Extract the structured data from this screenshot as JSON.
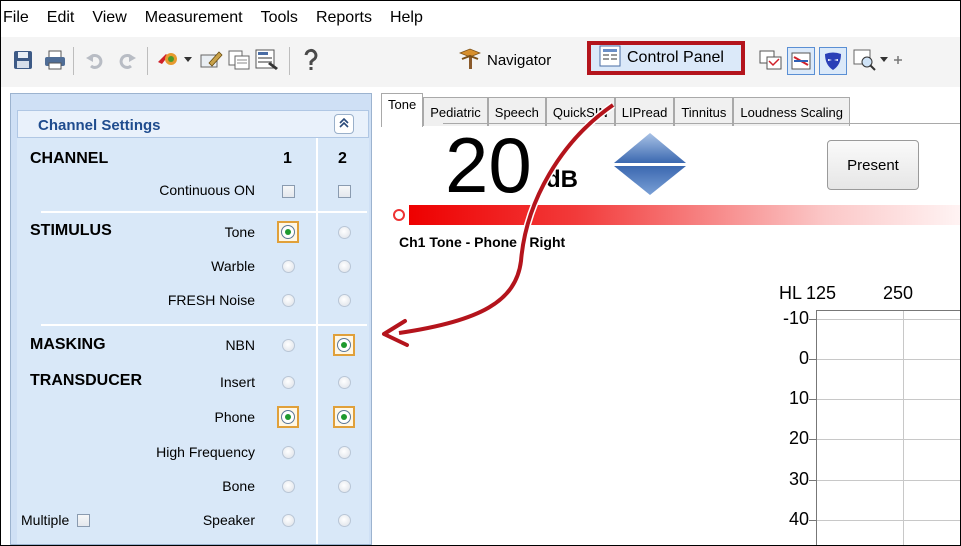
{
  "menu": [
    "File",
    "Edit",
    "View",
    "Measurement",
    "Tools",
    "Reports",
    "Help"
  ],
  "toolbar": {
    "icons": [
      "save-icon",
      "print-icon",
      "undo-icon",
      "redo-icon",
      "patient-icon",
      "edit-icon",
      "session-icon",
      "report-icon",
      "help-icon"
    ],
    "navigator_label": "Navigator",
    "control_panel_label": "Control Panel",
    "highlight_color": "#b4141c"
  },
  "channel_settings": {
    "title": "Channel Settings",
    "column_headers": [
      "1",
      "2"
    ],
    "channel": {
      "section": "CHANNEL",
      "continuous_label": "Continuous ON",
      "ch1_checked": false,
      "ch2_checked": false
    },
    "stimulus": {
      "section": "STIMULUS",
      "options": [
        {
          "label": "Tone",
          "ch1": true,
          "ch2": false
        },
        {
          "label": "Warble",
          "ch1": false,
          "ch2": false
        },
        {
          "label": "FRESH Noise",
          "ch1": false,
          "ch2": false
        }
      ]
    },
    "masking": {
      "section": "MASKING",
      "option": {
        "label": "NBN",
        "ch1": false,
        "ch2": true
      }
    },
    "transducer": {
      "section": "TRANSDUCER",
      "options": [
        {
          "label": "Insert",
          "ch1": false,
          "ch2": false
        },
        {
          "label": "Phone",
          "ch1": true,
          "ch2": true
        },
        {
          "label": "High Frequency",
          "ch1": false,
          "ch2": false
        },
        {
          "label": "Bone",
          "ch1": false,
          "ch2": false
        },
        {
          "label": "Speaker",
          "ch1": false,
          "ch2": false
        }
      ],
      "multiple_label": "Multiple",
      "multiple_checked": false
    }
  },
  "tabs": [
    {
      "label": "Tone",
      "active": true
    },
    {
      "label": "Pediatric",
      "active": false
    },
    {
      "label": "Speech",
      "active": false
    },
    {
      "label": "QuickSIN",
      "active": false
    },
    {
      "label": "LIPread",
      "active": false
    },
    {
      "label": "Tinnitus",
      "active": false
    },
    {
      "label": "Loudness Scaling",
      "active": false
    }
  ],
  "level": {
    "value": "20",
    "unit": "dB"
  },
  "present_label": "Present",
  "channel_status": "Ch1  Tone - Phone - Right",
  "audiogram": {
    "hl_label": "HL",
    "frequencies": [
      "125",
      "250"
    ],
    "levels": [
      "-10",
      "0",
      "10",
      "20",
      "30",
      "40"
    ]
  },
  "colors": {
    "panel_bg": "#d9e8f8",
    "level_bar": "#ee0000",
    "selected_radio": "#1e9a2e"
  }
}
